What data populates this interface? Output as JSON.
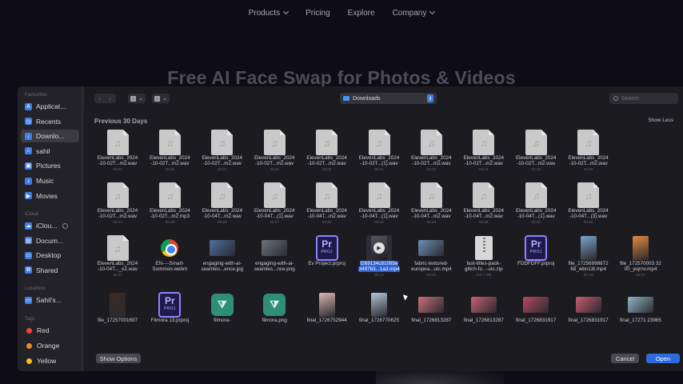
{
  "site": {
    "nav": [
      {
        "label": "Products",
        "dropdown": true
      },
      {
        "label": "Pricing",
        "dropdown": false
      },
      {
        "label": "Explore",
        "dropdown": false
      },
      {
        "label": "Company",
        "dropdown": true
      }
    ],
    "hero_title": "Free AI Face Swap for Photos & Videos"
  },
  "dialog": {
    "sidebar": {
      "favourites_heading": "Favourites",
      "favourites": [
        {
          "label": "Applicat...",
          "icon": "applications-icon"
        },
        {
          "label": "Recents",
          "icon": "clock-icon"
        },
        {
          "label": "Downlo...",
          "icon": "download-icon",
          "selected": true
        },
        {
          "label": "sahil",
          "icon": "home-icon"
        },
        {
          "label": "Pictures",
          "icon": "pictures-icon"
        },
        {
          "label": "Music",
          "icon": "music-icon"
        },
        {
          "label": "Movies",
          "icon": "movies-icon"
        }
      ],
      "icloud_heading": "iCloud",
      "icloud": [
        {
          "label": "iClou...",
          "icon": "icloud-icon"
        },
        {
          "label": "Docum...",
          "icon": "document-icon"
        },
        {
          "label": "Desktop",
          "icon": "desktop-icon"
        },
        {
          "label": "Shared",
          "icon": "shared-folder-icon"
        }
      ],
      "locations_heading": "Locations",
      "locations": [
        {
          "label": "Sahil's...",
          "icon": "laptop-icon"
        }
      ],
      "tags_heading": "Tags",
      "tags": [
        {
          "label": "Red",
          "color": "#e8453c"
        },
        {
          "label": "Orange",
          "color": "#f08a24"
        },
        {
          "label": "Yellow",
          "color": "#f5c518"
        }
      ]
    },
    "toolbar": {
      "back_glyph": "‹",
      "forward_glyph": "›",
      "location": "Downloads",
      "search_placeholder": "Search"
    },
    "section_title": "Previous 30 Days",
    "show_less": "Show Less",
    "files": [
      {
        "name": [
          "ElevenLabs_2024",
          "-10-02T...m2.wav"
        ],
        "meta": "00:04",
        "kind": "audio"
      },
      {
        "name": [
          "ElevenLabs_2024",
          "-10-02T...m2.wav"
        ],
        "meta": "00:25",
        "kind": "audio"
      },
      {
        "name": [
          "ElevenLabs_2024",
          "-10-02T...m2.wav"
        ],
        "meta": "00:21",
        "kind": "audio"
      },
      {
        "name": [
          "ElevenLabs_2024",
          "-10-02T...m2.wav"
        ],
        "meta": "00:23",
        "kind": "audio"
      },
      {
        "name": [
          "ElevenLabs_2024",
          "-10-02T...m2.wav"
        ],
        "meta": "00:39",
        "kind": "audio"
      },
      {
        "name": [
          "ElevenLabs_2024",
          "-10-02T...(1).wav"
        ],
        "meta": "00:31",
        "kind": "audio"
      },
      {
        "name": [
          "ElevenLabs_2024",
          "-10-02T...m2.wav"
        ],
        "meta": "00:03",
        "kind": "audio"
      },
      {
        "name": [
          "ElevenLabs_2024",
          "-10-02T...m2.wav"
        ],
        "meta": "00:14",
        "kind": "audio"
      },
      {
        "name": [
          "ElevenLabs_2024",
          "-10-02T...m2.wav"
        ],
        "meta": "00:33",
        "kind": "audio"
      },
      {
        "name": [
          "ElevenLabs_2024",
          "-10-02T...m2.wav"
        ],
        "meta": "00:20",
        "kind": "audio"
      },
      {
        "name": [
          "ElevenLabs_2024",
          "-10-02T...m2.wav"
        ],
        "meta": "00:24",
        "kind": "audio"
      },
      {
        "name": [
          "ElevenLabs_2024",
          "-10-02T...m2.mp3"
        ],
        "meta": "00:28",
        "kind": "audio"
      },
      {
        "name": [
          "ElevenLabs_2024",
          "-10-04T...m2.wav"
        ],
        "meta": "00:29",
        "kind": "audio"
      },
      {
        "name": [
          "ElevenLabs_2024",
          "-10-04T...(1).wav"
        ],
        "meta": "00:27",
        "kind": "audio"
      },
      {
        "name": [
          "ElevenLabs_2024",
          "-10-04T...m2.wav"
        ],
        "meta": "00:22",
        "kind": "audio"
      },
      {
        "name": [
          "ElevenLabs_2024",
          "-10-04T...(1).wav"
        ],
        "meta": "00:26",
        "kind": "audio"
      },
      {
        "name": [
          "ElevenLabs_2024",
          "-10-04T...m2.wav"
        ],
        "meta": "00:24",
        "kind": "audio"
      },
      {
        "name": [
          "ElevenLabs_2024",
          "-10-04T...m2.wav"
        ],
        "meta": "00:38",
        "kind": "audio"
      },
      {
        "name": [
          "ElevenLabs_2024",
          "-10-04T...(1).wav"
        ],
        "meta": "00:40",
        "kind": "audio"
      },
      {
        "name": [
          "ElevenLabs_2024",
          "-10-04T...(3).wav"
        ],
        "meta": "00:20",
        "kind": "audio"
      },
      {
        "name": [
          "ElevenLabs_2024",
          "-10-04T..._e1.wav"
        ],
        "meta": "00:27",
        "kind": "audio"
      },
      {
        "name": [
          "EN----Smart-",
          "Summon.webm"
        ],
        "meta": "",
        "kind": "chrome"
      },
      {
        "name": [
          "engaging-with-ai-",
          "seamles...ence.jpg"
        ],
        "meta": "",
        "kind": "image-land",
        "color": "#4f6fa0"
      },
      {
        "name": [
          "engaging-with-ai-",
          "seamles...nce.png"
        ],
        "meta": "",
        "kind": "image-land",
        "color": "#6d7280"
      },
      {
        "name": [
          "Ev Project.prproj"
        ],
        "meta": "",
        "kind": "premiere"
      },
      {
        "name": [
          "f269134c81095e",
          "349763...1a3.mp4"
        ],
        "meta": "00:13",
        "kind": "video",
        "selected": true
      },
      {
        "name": [
          "fabric-textured-",
          "europea...utc.mp4"
        ],
        "meta": "00:20",
        "kind": "image-land",
        "color": "#6f8fb5"
      },
      {
        "name": [
          "fast-titles-pack-",
          "glitch-fo...-utc.zip"
        ],
        "meta": "216.7 MB",
        "kind": "zip"
      },
      {
        "name": [
          "FDDFDFF.prproj"
        ],
        "meta": "",
        "kind": "premiere"
      },
      {
        "name": [
          "file_17256998672",
          "68_wbn13t.mp4"
        ],
        "meta": "00:43",
        "kind": "image-port",
        "color": "#7aa4c8"
      },
      {
        "name": [
          "file_172570003 32",
          "00_yiqrnv.mp4"
        ],
        "meta": "00:37",
        "kind": "image-port",
        "color": "#e08a3c"
      },
      {
        "name": [
          "file_17257001697"
        ],
        "meta": "",
        "kind": "image-port",
        "color": "#3b2a22"
      },
      {
        "name": [
          "Filmora 13.prproj"
        ],
        "meta": "",
        "kind": "premiere"
      },
      {
        "name": [
          "filmora-"
        ],
        "meta": "",
        "kind": "filmora"
      },
      {
        "name": [
          "filmora.png"
        ],
        "meta": "",
        "kind": "filmora"
      },
      {
        "name": [
          "final_1726752944"
        ],
        "meta": "",
        "kind": "image-port",
        "color": "#d9b7b0"
      },
      {
        "name": [
          "final_1726770625"
        ],
        "meta": "",
        "kind": "image-port",
        "color": "#b5c6d8"
      },
      {
        "name": [
          "final_1726813287"
        ],
        "meta": "",
        "kind": "image-land",
        "color": "#c8707a"
      },
      {
        "name": [
          "final_1726813287"
        ],
        "meta": "",
        "kind": "image-land",
        "color": "#c85f72"
      },
      {
        "name": [
          "final_1726831917"
        ],
        "meta": "",
        "kind": "image-land",
        "color": "#b84a62"
      },
      {
        "name": [
          "final_1726831917"
        ],
        "meta": "",
        "kind": "image-land",
        "color": "#c75b70"
      },
      {
        "name": [
          "final_17271 23965"
        ],
        "meta": "",
        "kind": "image-land",
        "color": "#8fb7c3"
      }
    ],
    "footer": {
      "show_options": "Show Options",
      "cancel": "Cancel",
      "open": "Open"
    }
  }
}
